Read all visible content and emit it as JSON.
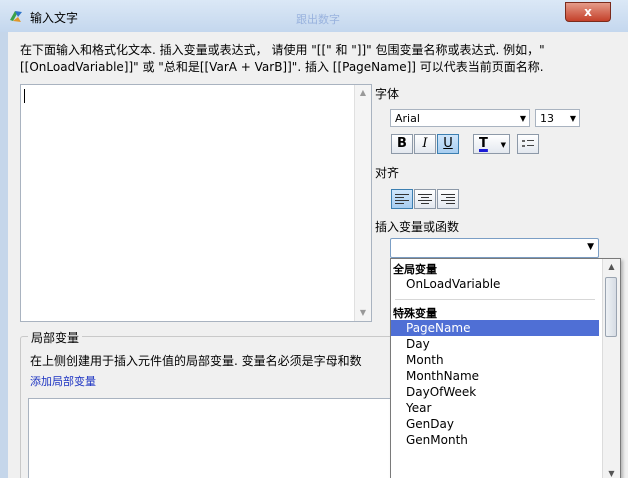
{
  "window": {
    "title": "输入文字",
    "blurred_title": "跟出数字",
    "close": "x"
  },
  "instructions": "在下面输入和格式化文本. 插入变量或表达式， 请使用 \"[[\" 和 \"]]\" 包围变量名称或表达式. 例如，\"[[OnLoadVariable]]\" 或 \"总和是[[VarA + VarB]]\". 插入 [[PageName]] 可以代表当前页面名称.",
  "font_section": {
    "label": "字体",
    "family": "Arial",
    "size": "13",
    "bold_label": "B",
    "italic_label": "I",
    "underline_label": "U",
    "color_label": "T"
  },
  "align_section": {
    "label": "对齐"
  },
  "insert_section": {
    "label": "插入变量或函数",
    "combo_value": ""
  },
  "dropdown": {
    "group_global": "全局变量",
    "global_items": [
      "OnLoadVariable"
    ],
    "group_special": "特殊变量",
    "special_items": [
      "PageName",
      "Day",
      "Month",
      "MonthName",
      "DayOfWeek",
      "Year",
      "GenDay",
      "GenMonth"
    ],
    "selected": "PageName"
  },
  "local_vars": {
    "title": "局部变量",
    "description": "在上侧创建用于插入元件值的局部变量. 变量名必须是字母和数",
    "add_link": "添加局部变量"
  },
  "colors": {
    "selection": "#4f6fd5",
    "link": "#1d34c2",
    "font_color_bar": "#1b1bd6"
  }
}
